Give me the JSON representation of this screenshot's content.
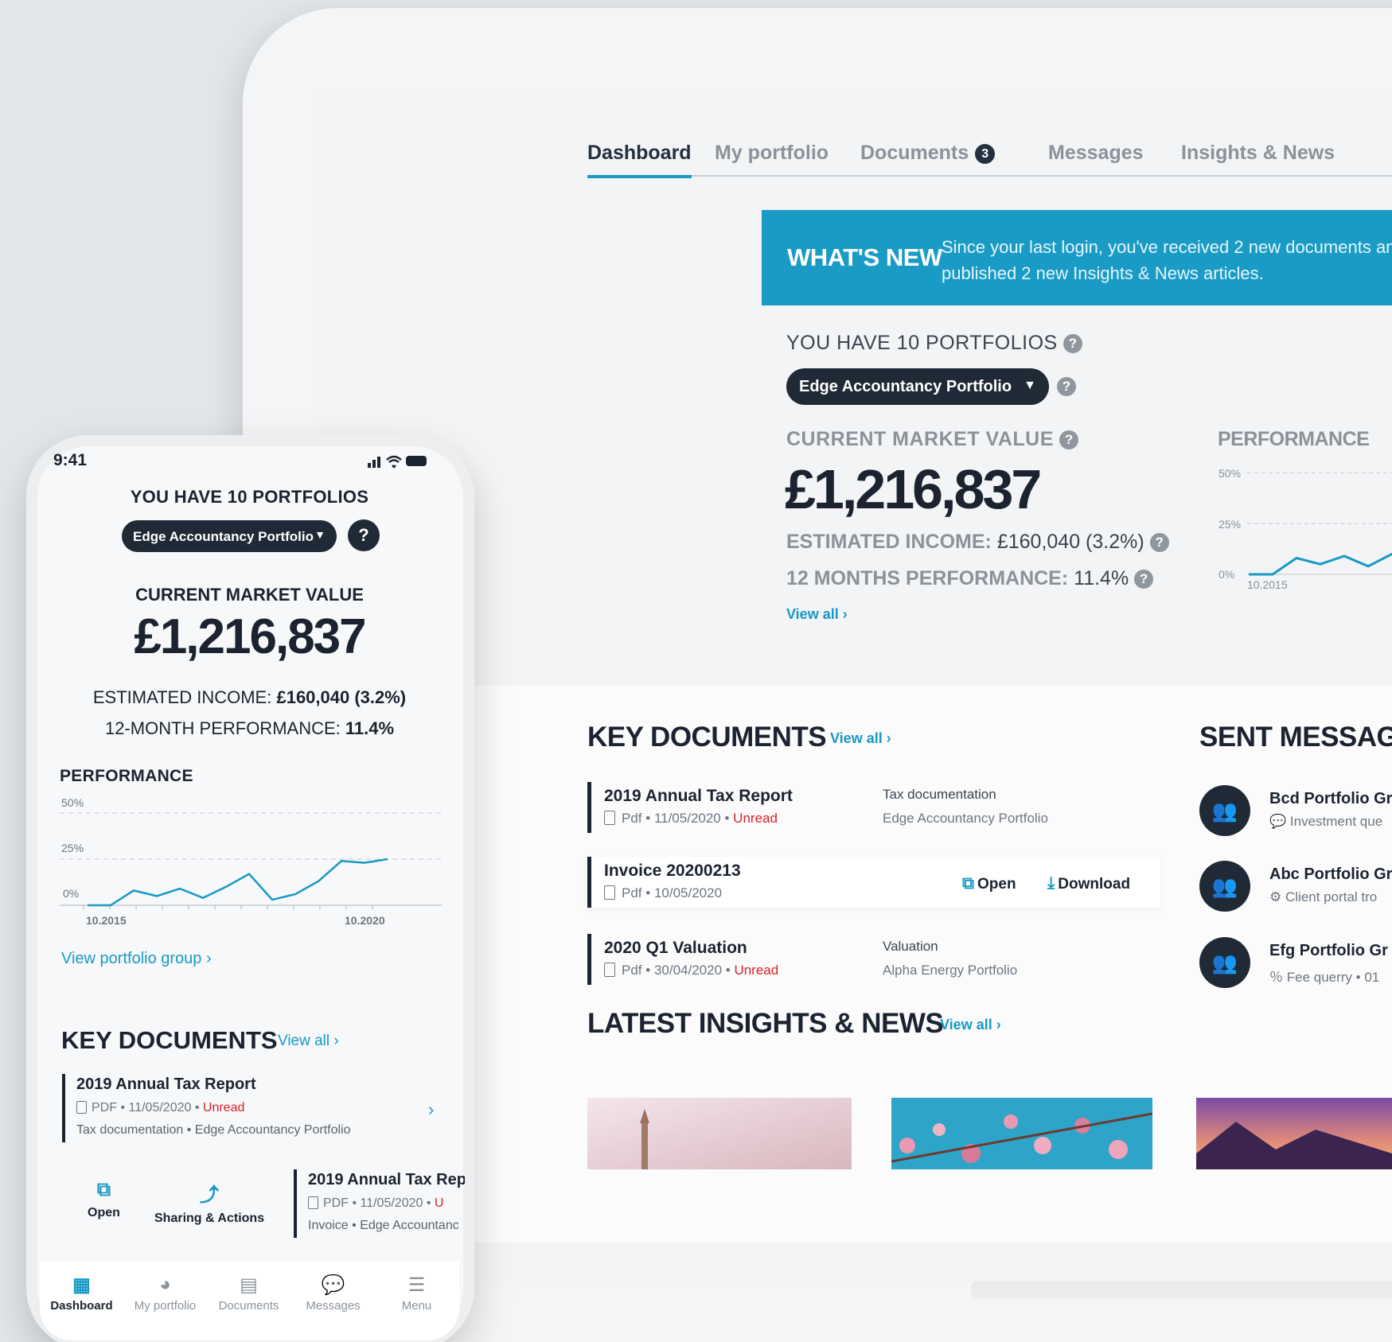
{
  "desktop": {
    "tabs": [
      {
        "label": "Dashboard",
        "active": true
      },
      {
        "label": "My portfolio"
      },
      {
        "label": "Documents",
        "badge": "3"
      },
      {
        "label": "Messages"
      },
      {
        "label": "Insights & News"
      }
    ],
    "whats_new": {
      "title": "WHAT'S NEW",
      "line1": "Since your last login, you've received 2 new documents an",
      "line2": "published 2 new Insights & News articles."
    },
    "portfolios_title": "YOU HAVE 10 PORTFOLIOS",
    "selected_portfolio": "Edge Accountancy Portfolio",
    "cmv_label": "CURRENT MARKET VALUE",
    "cmv_value": "£1,216,837",
    "est_income_label": "ESTIMATED INCOME:",
    "est_income_value": "£160,040 (3.2%)",
    "perf12_label": "12 MONTHS PERFORMANCE:",
    "perf12_value": "11.4%",
    "view_all": "View all",
    "performance": {
      "title": "PERFORMANCE",
      "y_ticks": [
        "50%",
        "25%",
        "0%"
      ],
      "x_first": "10.2015"
    },
    "key_documents": {
      "title": "KEY DOCUMENTS",
      "link": "View all",
      "docs": [
        {
          "title": "2019 Annual Tax Report",
          "type": "Pdf",
          "date": "11/05/2020",
          "status": "Unread",
          "category": "Tax documentation",
          "portfolio": "Edge Accountancy Portfolio"
        },
        {
          "title": "Invoice 20200213",
          "type": "Pdf",
          "date": "10/05/2020",
          "open": "Open",
          "download": "Download"
        },
        {
          "title": "2020 Q1 Valuation",
          "type": "Pdf",
          "date": "30/04/2020",
          "status": "Unread",
          "category": "Valuation",
          "portfolio": "Alpha Energy Portfolio"
        }
      ]
    },
    "sent_messages": {
      "title": "SENT MESSAGE",
      "items": [
        {
          "title": "Bcd Portfolio Gr",
          "sub": "Investment que"
        },
        {
          "title": "Abc Portfolio Gr",
          "sub": "Client portal tro"
        },
        {
          "title": "Efg Portfolio Gr",
          "sub": "Fee querry • 01"
        }
      ]
    },
    "insights": {
      "title": "LATEST INSIGHTS & NEWS",
      "link": "View all"
    }
  },
  "phone": {
    "time": "9:41",
    "portfolios_title": "YOU HAVE 10 PORTFOLIOS",
    "selected_portfolio": "Edge Accountancy Portfolio",
    "help": "?",
    "cmv_label": "CURRENT MARKET VALUE",
    "cmv_value": "£1,216,837",
    "income_label": "ESTIMATED INCOME:",
    "income_value": "£160,040 (3.2%)",
    "perf_label": "12-MONTH PERFORMANCE:",
    "perf_value": "11.4%",
    "perf_title": "PERFORMANCE",
    "y_ticks": [
      "50%",
      "25%",
      "0%"
    ],
    "x_ticks": [
      "10.2015",
      "10.2020"
    ],
    "view_group": "View portfolio group ›",
    "kd_title": "KEY DOCUMENTS",
    "kd_link": "View all ›",
    "doc": {
      "title": "2019 Annual Tax Report",
      "type": "PDF",
      "date": "11/05/2020",
      "status": "Unread",
      "sub": "Tax documentation • Edge Accountancy Portfolio"
    },
    "doc2": {
      "title": "2019 Annual Tax Rep",
      "type": "PDF",
      "date": "11/05/2020",
      "status": "U",
      "sub": "Invoice • Edge Accountanc"
    },
    "actions": {
      "open": "Open",
      "share": "Sharing & Actions"
    },
    "tabbar": [
      "Dashboard",
      "My portfolio",
      "Documents",
      "Messages",
      "Menu"
    ]
  },
  "chart_data": [
    {
      "type": "line",
      "title": "PERFORMANCE",
      "ylim": [
        0,
        50
      ],
      "y_ticks": [
        "0%",
        "25%",
        "50%"
      ],
      "x_ticks": [
        "10.2015",
        "10.2020"
      ],
      "series": [
        {
          "values": [
            0,
            0,
            8,
            5,
            9,
            4,
            10,
            17,
            3,
            6,
            13,
            24,
            23,
            25
          ]
        }
      ],
      "colors": {
        "line": "#1899c4"
      }
    }
  ]
}
